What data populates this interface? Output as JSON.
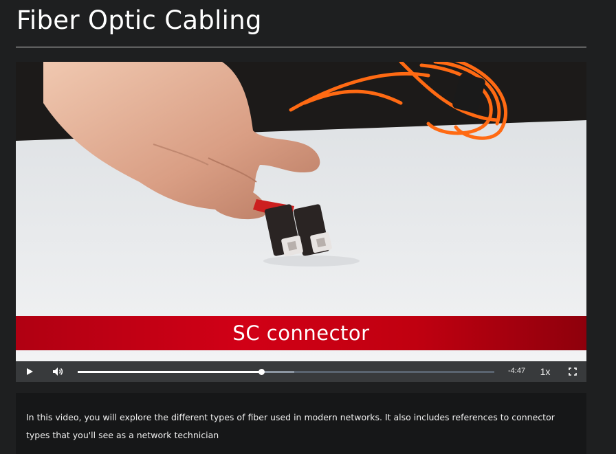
{
  "page": {
    "title": "Fiber Optic Cabling"
  },
  "video": {
    "caption": "SC connector",
    "progress_fraction": 0.44,
    "buffered_fraction": 0.52,
    "time_remaining": "-4:47",
    "speed": "1x",
    "icons": {
      "play": "play-icon",
      "volume": "volume-icon",
      "fullscreen": "fullscreen-icon"
    }
  },
  "description": {
    "text": "In this video, you will explore the different types of fiber used in modern networks. It also includes references to connector types that you'll see as a network technician"
  },
  "colors": {
    "caption_bar": "#d10016",
    "cable_orange": "#ff6a13",
    "background": "#1e1f20"
  }
}
